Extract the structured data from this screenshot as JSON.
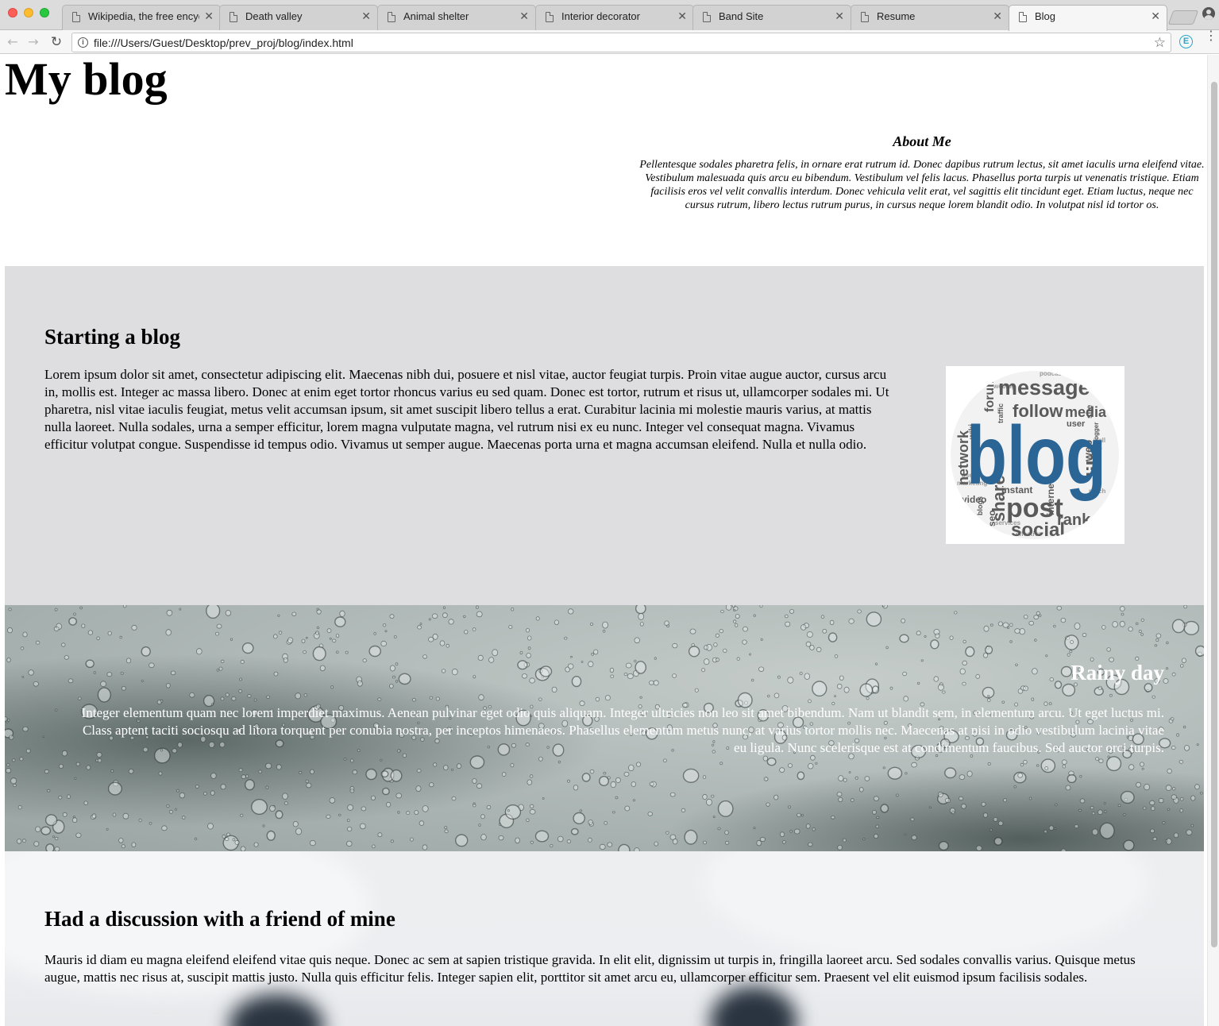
{
  "browser": {
    "tabs": [
      {
        "title": "Wikipedia, the free encyc",
        "active": false
      },
      {
        "title": "Death valley",
        "active": false
      },
      {
        "title": "Animal shelter",
        "active": false
      },
      {
        "title": "Interior decorator",
        "active": false
      },
      {
        "title": "Band Site",
        "active": false
      },
      {
        "title": "Resume",
        "active": false
      },
      {
        "title": "Blog",
        "active": true
      }
    ],
    "url": "file:///Users/Guest/Desktop/prev_proj/blog/index.html"
  },
  "page": {
    "title": "My blog",
    "about": {
      "heading": "About Me",
      "text": "Pellentesque sodales pharetra felis, in ornare erat rutrum id. Donec dapibus rutrum lectus, sit amet iaculis urna eleifend vitae. Vestibulum malesuada quis arcu eu bibendum. Vestibulum vel felis lacus. Phasellus porta turpis ut venenatis tristique. Etiam facilisis eros vel velit convallis interdum. Donec vehicula velit erat, vel sagittis elit tincidunt eget. Etiam luctus, neque nec cursus rutrum, libero lectus rutrum purus, in cursus neque lorem blandit odio. In volutpat nisl id tortor os."
    },
    "posts": [
      {
        "heading": "Starting a blog",
        "text": "Lorem ipsum dolor sit amet, consectetur adipiscing elit. Maecenas nibh dui, posuere et nisl vitae, auctor feugiat turpis. Proin vitae augue auctor, cursus arcu in, mollis est. Integer ac massa libero. Donec at enim eget tortor rhoncus varius eu sed quam. Donec est tortor, rutrum et risus ut, ullamcorper sodales mi. Ut pharetra, nisl vitae iaculis feugiat, metus velit accumsan ipsum, sit amet suscipit libero tellus a erat. Curabitur lacinia mi molestie mauris varius, at mattis nulla laoreet. Nulla sodales, urna a semper efficitur, lorem magna vulputate magna, vel rutrum nisi ex eu nunc. Integer vel consequat magna. Vivamus efficitur volutpat congue. Suspendisse id tempus odio. Vivamus ut semper augue. Maecenas porta urna et magna accumsan eleifend. Nulla et nulla odio.",
        "image_words": {
          "main": "blog",
          "words": [
            "message",
            "follow",
            "media",
            "forum",
            "network",
            "post",
            "social",
            "share",
            "like",
            "rank",
            "web",
            "video",
            "user",
            "wiki",
            "traffic",
            "blogger",
            "internet",
            "instant",
            "seo",
            "users",
            "marketing",
            "site",
            "podcast",
            "weblog",
            "wall",
            "reach",
            "effective",
            "networking",
            "services",
            "blogs"
          ]
        }
      },
      {
        "heading": "Rainy day",
        "text": "Integer elementum quam nec lorem imperdiet maximus. Aenean pulvinar eget odio quis aliquam. Integer ultricies non leo sit amet bibendum. Nam ut blandit sem, in elementum arcu. Ut eget luctus mi. Class aptent taciti sociosqu ad litora torquent per conubia nostra, per inceptos himenaeos. Phasellus elementum metus nunc, at varius tortor mollis nec. Maecenas at nisi in odio vestibulum lacinia vitae eu ligula. Nunc scelerisque est at condimentum faucibus. Sed auctor orci turpis."
      },
      {
        "heading": "Had a discussion with a friend of mine",
        "text": "Mauris id diam eu magna eleifend eleifend vitae quis neque. Donec ac sem at sapien tristique gravida. In elit elit, dignissim ut turpis in, fringilla laoreet arcu. Sed sodales convallis varius. Quisque metus augue, mattis nec risus at, suscipit mattis justo. Nulla quis efficitur felis. Integer sapien elit, porttitor sit amet arcu eu, ullamcorper efficitur sem. Praesent vel elit euismod ipsum facilisis sodales."
      }
    ]
  },
  "colors": {
    "section_grey": "#dedee0",
    "wordcloud_blue": "#2a6596",
    "wordcloud_dark": "#3d3d3d"
  }
}
